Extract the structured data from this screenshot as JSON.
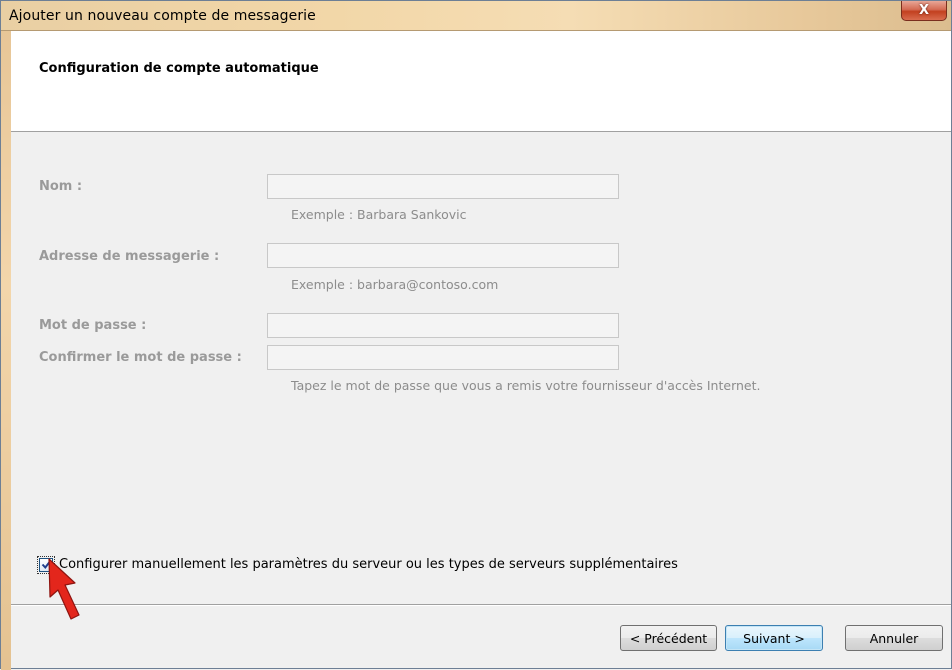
{
  "window": {
    "title": "Ajouter un nouveau compte de messagerie",
    "close_label": "X"
  },
  "header": {
    "heading": "Configuration de compte automatique"
  },
  "form": {
    "name_label": "Nom :",
    "name_value": "",
    "name_hint": "Exemple : Barbara Sankovic",
    "email_label": "Adresse de messagerie :",
    "email_value": "",
    "email_hint": "Exemple : barbara@contoso.com",
    "password_label": "Mot de passe :",
    "password_value": "",
    "confirm_label": "Confirmer le mot de passe :",
    "confirm_value": "",
    "password_hint": "Tapez le mot de passe que vous a remis votre fournisseur d'accès Internet."
  },
  "manual_config": {
    "label": "Configurer manuellement les paramètres du serveur ou les types de serveurs supplémentaires",
    "checked": true
  },
  "buttons": {
    "back": "< Précédent",
    "next": "Suivant >",
    "cancel": "Annuler"
  },
  "colors": {
    "pointer_red": "#e3261c",
    "disabled_text": "#9a9a9a"
  },
  "icons": {
    "close": "close-icon",
    "check": "checkmark-icon",
    "pointer": "red-arrow-pointer-icon"
  }
}
